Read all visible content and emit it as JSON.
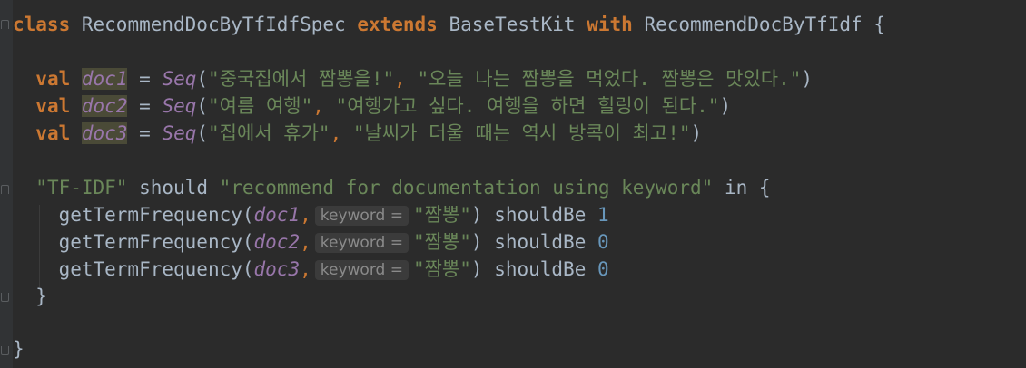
{
  "code": {
    "line1": {
      "kw_class": "class",
      "class_name": "RecommendDocByTfIdfSpec",
      "kw_extends": "extends",
      "parent": "BaseTestKit",
      "kw_with": "with",
      "trait": "RecommendDocByTfIdf",
      "brace": "{"
    },
    "vals": [
      {
        "kw": "val",
        "name": "doc1",
        "eq": "=",
        "fn": "Seq",
        "open": "(",
        "s1": "\"중국집에서 짬뽕을!\"",
        "sep": ", ",
        "s2": "\"오늘 나는 짬뽕을 먹었다. 짬뽕은 맛있다.\"",
        "close": ")"
      },
      {
        "kw": "val",
        "name": "doc2",
        "eq": "=",
        "fn": "Seq",
        "open": "(",
        "s1": "\"여름 여행\"",
        "sep": ", ",
        "s2": "\"여행가고 싶다. 여행을 하면 힐링이 된다.\"",
        "close": ")"
      },
      {
        "kw": "val",
        "name": "doc3",
        "eq": "=",
        "fn": "Seq",
        "open": "(",
        "s1": "\"집에서 휴가\"",
        "sep": ", ",
        "s2": "\"날씨가 더울 때는 역시 방콕이 최고!\"",
        "close": ")"
      }
    ],
    "spec": {
      "title": "\"TF-IDF\"",
      "should": "should",
      "desc": "\"recommend for documentation using keyword\"",
      "in": "in",
      "brace": "{"
    },
    "asserts": [
      {
        "fn": "getTermFrequency(",
        "arg": "doc1",
        "comma": ",",
        "hint": "keyword =",
        "str": "\"짬뽕\"",
        "close": ")",
        "matcher": "shouldBe",
        "expected": "1"
      },
      {
        "fn": "getTermFrequency(",
        "arg": "doc2",
        "comma": ",",
        "hint": "keyword =",
        "str": "\"짬뽕\"",
        "close": ")",
        "matcher": "shouldBe",
        "expected": "0"
      },
      {
        "fn": "getTermFrequency(",
        "arg": "doc3",
        "comma": ",",
        "hint": "keyword =",
        "str": "\"짬뽕\"",
        "close": ")",
        "matcher": "shouldBe",
        "expected": "0"
      }
    ],
    "inner_close": "}",
    "outer_close": "}"
  },
  "colors": {
    "background": "#2b2b2b",
    "keyword": "#cc7832",
    "string": "#6a8759",
    "number": "#6897bb",
    "variable": "#9876aa",
    "text": "#a9b7c6"
  }
}
